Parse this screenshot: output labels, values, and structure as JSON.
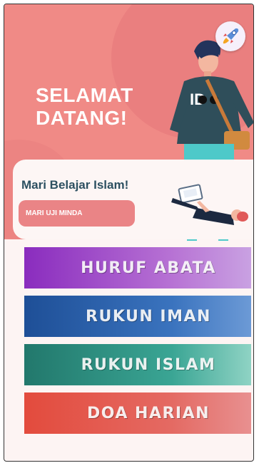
{
  "hero": {
    "title_line1": "SELAMAT",
    "title_line2": "DATANG!",
    "settings_icon": "rocket-icon"
  },
  "card": {
    "title": "Mari Belajar Islam!",
    "quiz_button": "MARI UJI MINDA"
  },
  "menu": [
    {
      "label": "HURUF ABATA",
      "color": "#8a2cbe"
    },
    {
      "label": "RUKUN IMAN",
      "color": "#1e4f97"
    },
    {
      "label": "RUKUN ISLAM",
      "color": "#22786c"
    },
    {
      "label": "DOA HARIAN",
      "color": "#e34b3d"
    }
  ],
  "colors": {
    "hero_bg": "#f08a86",
    "card_title": "#2c5061",
    "quiz_button": "#ea8486"
  }
}
